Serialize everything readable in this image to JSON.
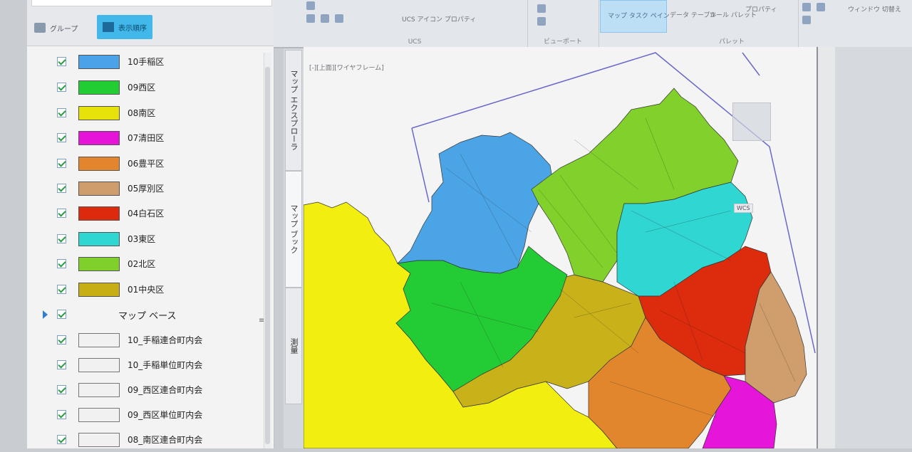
{
  "left_panel": {
    "group_button": "グループ",
    "display_button": "表示順序",
    "layers": [
      {
        "label": "10手稲区",
        "color": "#4aa3e6",
        "checked": true
      },
      {
        "label": "09西区",
        "color": "#22cc33",
        "checked": true
      },
      {
        "label": "08南区",
        "color": "#e6e20a",
        "checked": true
      },
      {
        "label": "07清田区",
        "color": "#e614d9",
        "checked": true
      },
      {
        "label": "06豊平区",
        "color": "#e2852c",
        "checked": true
      },
      {
        "label": "05厚別区",
        "color": "#cf9d6c",
        "checked": true
      },
      {
        "label": "04白石区",
        "color": "#dd2a0c",
        "checked": true
      },
      {
        "label": "03東区",
        "color": "#2fd6d2",
        "checked": true
      },
      {
        "label": "02北区",
        "color": "#7fd02a",
        "checked": true
      },
      {
        "label": "01中央区",
        "color": "#c6ae14",
        "checked": true
      }
    ],
    "base_group": "マップ ベース",
    "base_layers": [
      {
        "label": "10_手稲連合町内会",
        "checked": true
      },
      {
        "label": "10_手稲単位町内会",
        "checked": true
      },
      {
        "label": "09_西区連合町内会",
        "checked": true
      },
      {
        "label": "09_西区単位町内会",
        "checked": true
      },
      {
        "label": "08_南区連合町内会",
        "checked": true
      }
    ]
  },
  "side_tabs": [
    "マップ エクスプローラ",
    "マップ ブック",
    "測量"
  ],
  "ribbon": {
    "ucs_texts": [
      "UCS アイコン プロパティ"
    ],
    "groups": [
      "UCS",
      "ビューポート",
      "パレット"
    ],
    "buttons": [
      "マップ タスク ペイン",
      "データ テーブル",
      "ツール パレット",
      "プロパティ",
      "ウィンドウ 切替え"
    ]
  },
  "canvas": {
    "title": "[-][上面][ワイヤフレーム]",
    "ucs_label": "WCS"
  }
}
